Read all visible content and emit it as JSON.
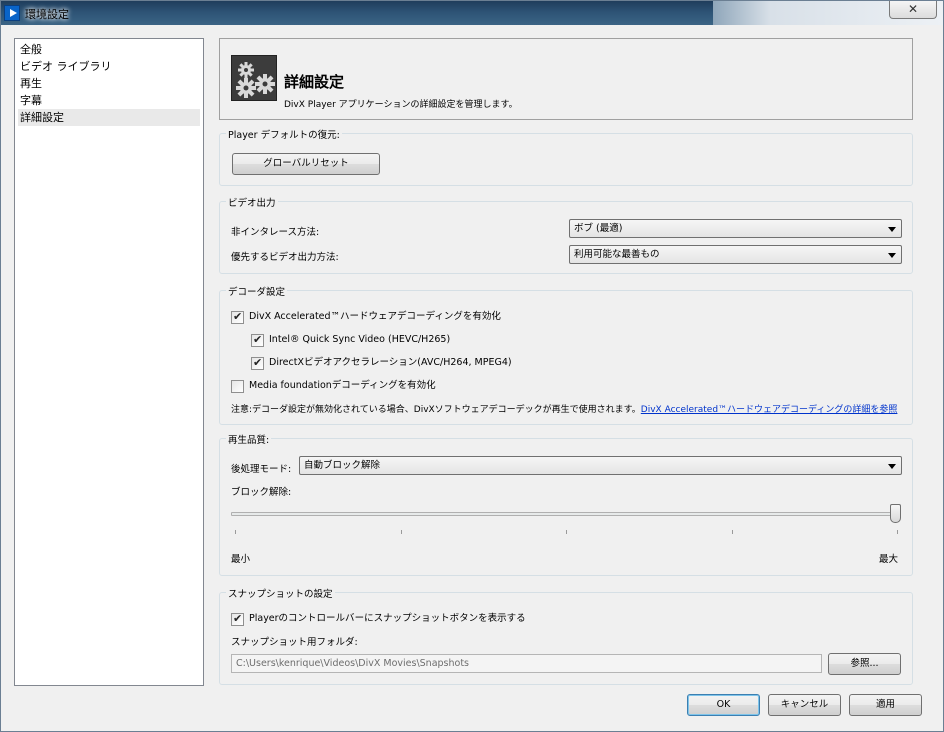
{
  "window": {
    "title": "環境設定",
    "close_glyph": "✕"
  },
  "sidebar": {
    "items": [
      {
        "label": "全般"
      },
      {
        "label": "ビデオ ライブラリ"
      },
      {
        "label": "再生"
      },
      {
        "label": "字幕"
      },
      {
        "label": "詳細設定"
      }
    ],
    "selected_index": 4
  },
  "header": {
    "title": "詳細設定",
    "description": "DivX Player アプリケーションの詳細設定を管理します。"
  },
  "restore": {
    "group_label": "Player デフォルトの復元:",
    "reset_button": "グローバルリセット"
  },
  "video_output": {
    "group_label": "ビデオ出力",
    "deinterlace_label": "非インタレース方法:",
    "deinterlace_value": "ボブ (最適)",
    "preferred_label": "優先するビデオ出力方法:",
    "preferred_value": "利用可能な最善もの"
  },
  "decoder": {
    "group_label": "デコーダ設定",
    "hw_accel": {
      "label": "DivX Accelerated™ハードウェアデコーディングを有効化",
      "checked": true
    },
    "quicksync": {
      "label": "Intel® Quick Sync Video (HEVC/H265)",
      "checked": true
    },
    "directx": {
      "label": "DirectXビデオアクセラレーション(AVC/H264, MPEG4)",
      "checked": true
    },
    "media_foundation": {
      "label": "Media foundationデコーディングを有効化",
      "checked": false
    },
    "note": "注意:デコーダ設定が無効化されている場合、DivXソフトウェアデコーデックが再生で使用されます。",
    "link": "DivX Accelerated™ハードウェアデコーディングの詳細を参照"
  },
  "playback_quality": {
    "group_label": "再生品質:",
    "postprocess_label": "後処理モード:",
    "postprocess_value": "自動ブロック解除",
    "deblock_label": "ブロック解除:",
    "slider_level": 1.0,
    "min_label": "最小",
    "max_label": "最大"
  },
  "snapshot": {
    "group_label": "スナップショットの設定",
    "show_button": {
      "label": "Playerのコントロールバーにスナップショットボタンを表示する",
      "checked": true
    },
    "folder_label": "スナップショット用フォルダ:",
    "folder_value": "C:\\Users\\kenrique\\Videos\\DivX Movies\\Snapshots",
    "browse_button": "参照..."
  },
  "footer": {
    "ok_button": "OK",
    "cancel_button": "キャンセル",
    "apply_button": "適用"
  }
}
